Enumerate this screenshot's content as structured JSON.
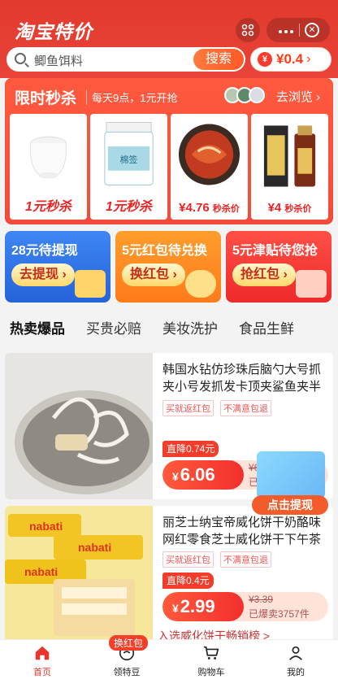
{
  "header": {
    "brand": "淘宝特价",
    "search_placeholder": "鲫鱼饵料",
    "search_button": "搜索",
    "coin_value": "¥0.4",
    "coin_icon_text": "¥"
  },
  "flash_sale": {
    "title": "限时秒杀",
    "subtitle": "每天9点，1元开抢",
    "browse": "去浏览",
    "products": [
      {
        "price": "1元秒杀",
        "style": "big"
      },
      {
        "price": "1元秒杀",
        "style": "big"
      },
      {
        "price": "¥4.76",
        "unit": "秒杀价",
        "style": "small"
      },
      {
        "price": "¥4",
        "unit": "秒杀价",
        "style": "small"
      }
    ]
  },
  "promos": [
    {
      "title": "28元待提现",
      "button": "去提现"
    },
    {
      "title": "5元红包待兑换",
      "button": "换红包"
    },
    {
      "title": "5元津贴待您抢",
      "button": "抢红包"
    }
  ],
  "tabs": [
    "热卖爆品",
    "买贵必赔",
    "美妆洗护",
    "食品生鲜"
  ],
  "cards": [
    {
      "title": "韩国水钻仿珍珠后脑勺大号抓夹小号发抓发卡顶夹鲨鱼夹半",
      "tags": [
        "买就返红包",
        "不满意包退"
      ],
      "drop": "直降0.74元",
      "yen": "¥",
      "price": "6.06",
      "orig": "¥6",
      "sold": "已"
    },
    {
      "title": "丽芝士纳宝帝威化饼干奶酪味网红零食芝士威化饼干下午茶",
      "tags": [
        "买就返红包",
        "不满意包退"
      ],
      "drop": "直降0.4元",
      "yen": "¥",
      "price": "2.99",
      "orig": "¥3.39",
      "sold": "已爆卖3757件"
    }
  ],
  "float_ad": {
    "button": "点击提现"
  },
  "entry_text": "入选威化饼干畅销榜 >",
  "nav": [
    {
      "label": "首页",
      "active": true
    },
    {
      "label": "领特豆",
      "badge": "换红包"
    },
    {
      "label": "购物车"
    },
    {
      "label": "我的"
    }
  ]
}
